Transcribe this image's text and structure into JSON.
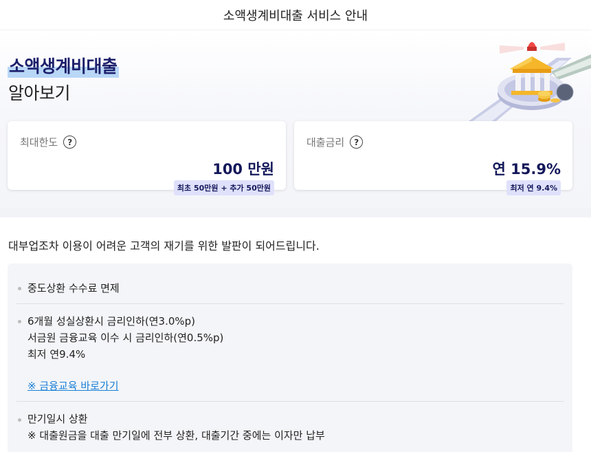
{
  "header": {
    "title": "소액생계비대출 서비스 안내"
  },
  "hero": {
    "title_highlight": "소액생계비대출",
    "title_sub": "알아보기",
    "illustration_icon": "bank-illustration-icon"
  },
  "cards": [
    {
      "label": "최대한도",
      "value": "100 만원",
      "chip": "최초 50만원 + 추가 50만원"
    },
    {
      "label": "대출금리",
      "value": "연 15.9%",
      "chip": "최저 연 9.4%"
    }
  ],
  "intro": "대부업조차 이용이 어려운 고객의 재기를 위한 발판이 되어드립니다.",
  "features": [
    {
      "lines": [
        "중도상환 수수료 면제"
      ]
    },
    {
      "lines": [
        "6개월 성실상환시 금리인하(연3.0%p)",
        "서금원 금융교육 이수 시 금리인하(연0.5%p)",
        "최저 연9.4%"
      ],
      "link": "※ 금융교육 바로가기"
    },
    {
      "lines": [
        "만기일시 상환",
        "※ 대출원금을 대출 만기일에 전부 상환, 대출기간 중에는 이자만 납부"
      ]
    }
  ],
  "colors": {
    "navy": "#14185a",
    "chip_bg": "#dfe1fb",
    "highlight": "#b9d7f7",
    "link": "#1a7fd6"
  }
}
